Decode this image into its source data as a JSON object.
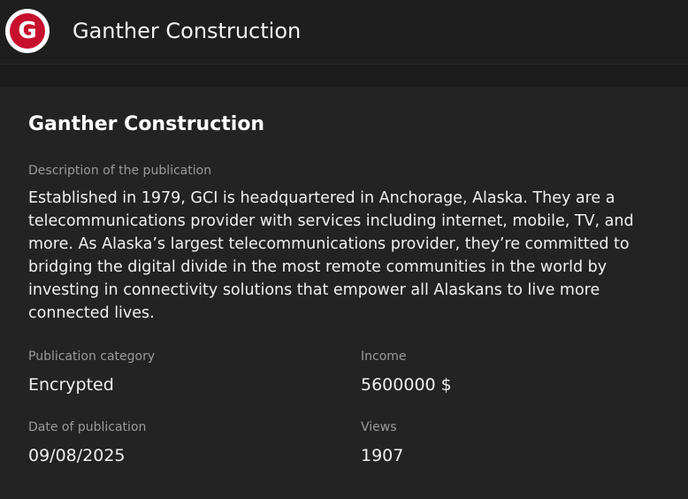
{
  "header": {
    "logo_letter": "G",
    "logo_colors": {
      "ring": "#ffffff",
      "fill": "#c8102e"
    },
    "title": "Ganther Construction"
  },
  "publication": {
    "title": "Ganther Construction",
    "description_label": "Description of the publication",
    "description": "Established in 1979, GCI is headquartered in Anchorage, Alaska. They are a telecommunications provider with services including internet, mobile, TV, and more. As Alaska’s largest telecommunications provider, they’re committed to bridging the digital divide in the most remote communities in the world by investing in connectivity solutions that empower all Alaskans to live more connected lives.",
    "category_label": "Publication category",
    "category": "Encrypted",
    "income_label": "Income",
    "income": "5600000 $",
    "date_label": "Date of publication",
    "date": "09/08/2025",
    "views_label": "Views",
    "views": "1907"
  }
}
